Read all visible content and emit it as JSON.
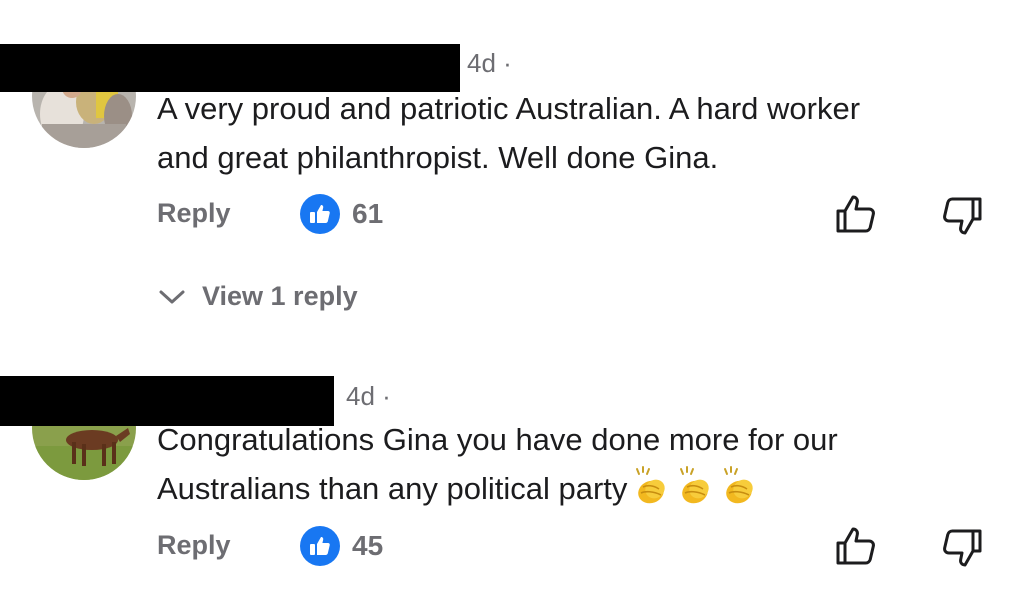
{
  "comments": [
    {
      "timestamp": "4d ·",
      "lines": [
        "A very proud and patriotic Australian. A hard worker",
        "and great philanthropist. Well done Gina."
      ],
      "reply_label": "Reply",
      "like_count": "61",
      "view_replies_label": "View 1 reply"
    },
    {
      "timestamp": "4d ·",
      "lines": [
        "Congratulations Gina you have done more for our",
        "Australians than any political party"
      ],
      "emoji": [
        "clapping-hands",
        "clapping-hands",
        "clapping-hands"
      ],
      "reply_label": "Reply",
      "like_count": "45"
    }
  ],
  "colors": {
    "text": "#1c1c1e",
    "secondary": "#6d6d72",
    "like_badge": "#1877f2",
    "redaction": "#000000"
  },
  "icons": [
    "thumbs-up-badge-icon",
    "upvote-icon",
    "downvote-icon",
    "chevron-down-icon",
    "clapping-hands-emoji"
  ]
}
